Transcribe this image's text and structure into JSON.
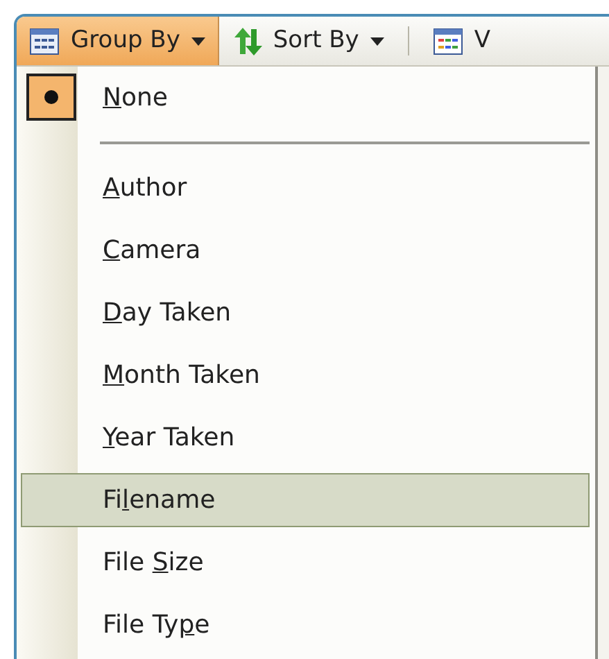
{
  "toolbar": [
    {
      "kind": "button",
      "label": "Group By",
      "dropdown": true,
      "pressed": true
    },
    {
      "kind": "button",
      "label": "Sort By",
      "dropdown": true,
      "pressed": false
    },
    {
      "kind": "separator"
    },
    {
      "kind": "button",
      "label": "V",
      "dropdown": false,
      "pressed": false
    }
  ],
  "menu": [
    {
      "kind": "item",
      "key": "N",
      "after": "one",
      "checked": true,
      "selected": false
    },
    {
      "kind": "separator"
    },
    {
      "kind": "item",
      "key": "A",
      "after": "uthor",
      "checked": false,
      "selected": false
    },
    {
      "kind": "item",
      "key": "C",
      "after": "amera",
      "checked": false,
      "selected": false
    },
    {
      "kind": "item",
      "key": "D",
      "after": "ay Taken",
      "checked": false,
      "selected": false
    },
    {
      "kind": "item",
      "key": "M",
      "after": "onth Taken",
      "checked": false,
      "selected": false
    },
    {
      "kind": "item",
      "key": "Y",
      "after": "ear Taken",
      "checked": false,
      "selected": false
    },
    {
      "kind": "item",
      "before": "Fi",
      "key": "l",
      "after": "ename",
      "checked": false,
      "selected": true
    },
    {
      "kind": "item",
      "before": "File ",
      "key": "S",
      "after": "ize",
      "checked": false,
      "selected": false
    },
    {
      "kind": "item",
      "before": "File Ty",
      "key": "p",
      "after": "e",
      "checked": false,
      "selected": false
    }
  ]
}
